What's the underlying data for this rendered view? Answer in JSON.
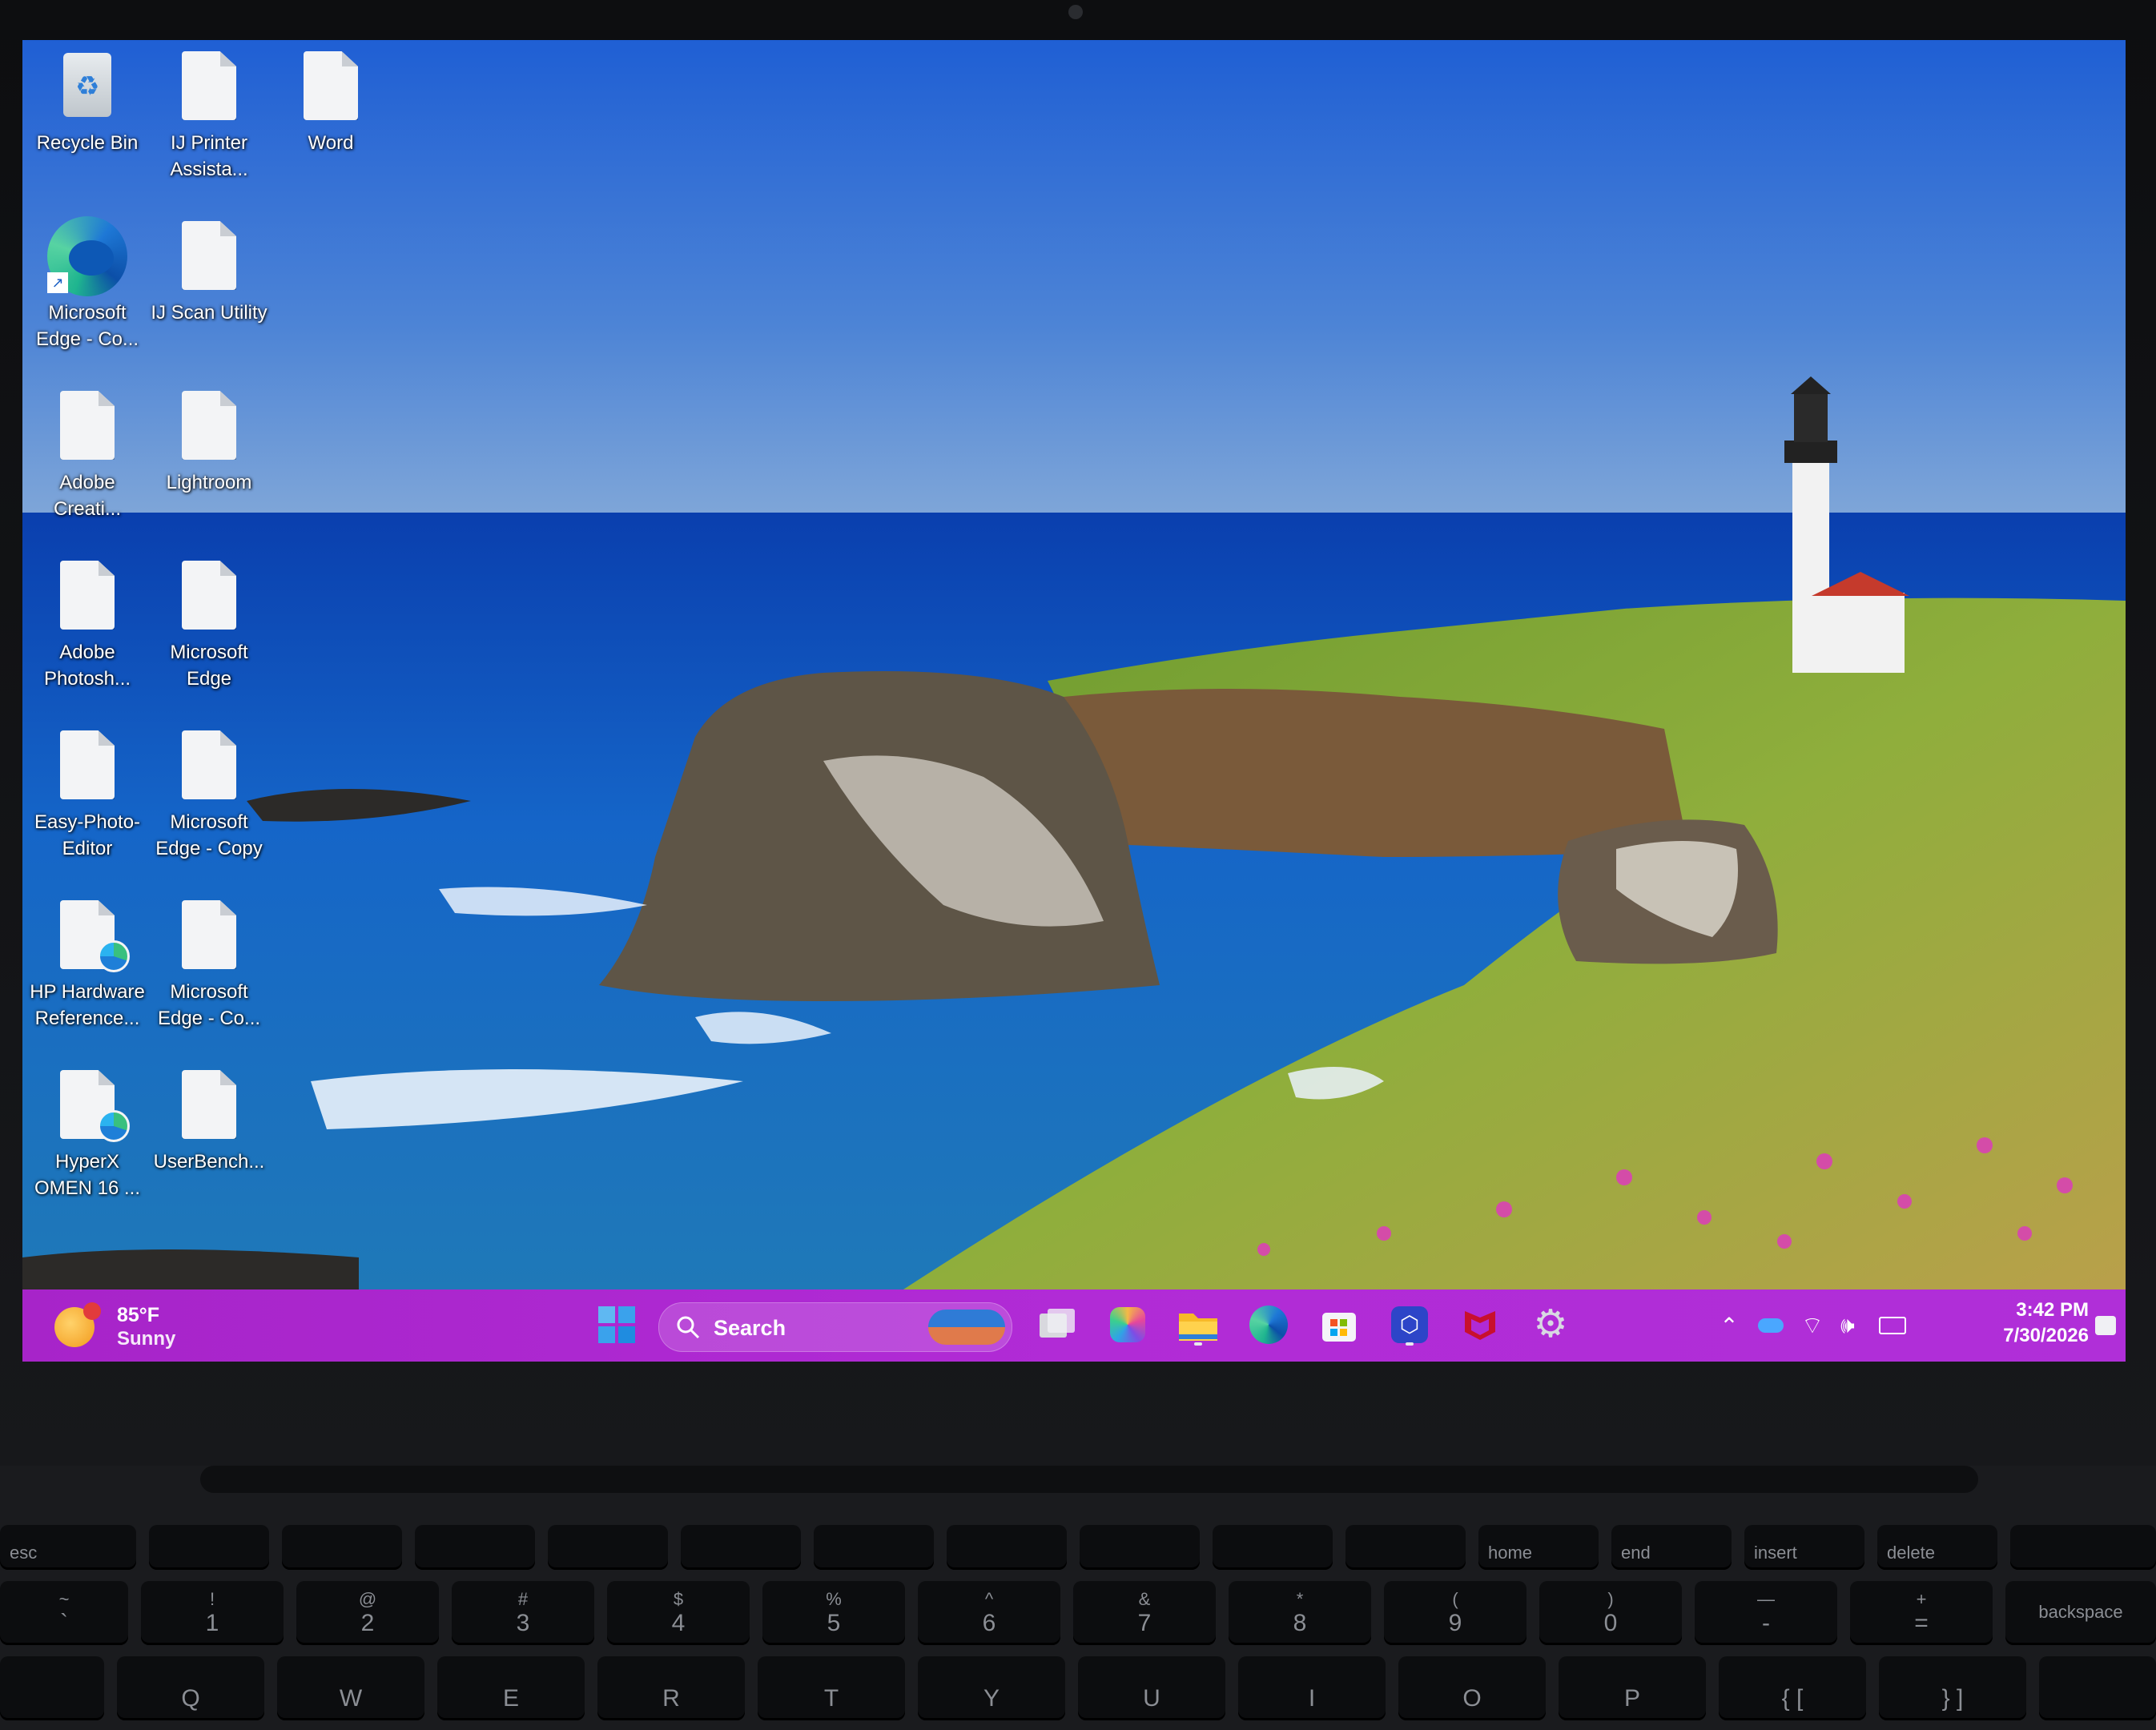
{
  "desktop": {
    "icons": [
      {
        "label": "Recycle Bin",
        "icon": "recycle-bin-icon"
      },
      {
        "label": "IJ Printer Assista...",
        "icon": "file-icon"
      },
      {
        "label": "Word",
        "icon": "file-icon"
      },
      {
        "label": "Microsoft Edge - Co...",
        "icon": "edge-icon"
      },
      {
        "label": "IJ Scan Utility",
        "icon": "file-icon"
      },
      {
        "label": "Adobe Creati...",
        "icon": "file-icon"
      },
      {
        "label": "Lightroom",
        "icon": "file-icon"
      },
      {
        "label": "Adobe Photosh...",
        "icon": "file-icon"
      },
      {
        "label": "Microsoft Edge",
        "icon": "file-icon"
      },
      {
        "label": "Easy-Photo-Editor",
        "icon": "file-icon"
      },
      {
        "label": "Microsoft Edge - Copy",
        "icon": "file-icon"
      },
      {
        "label": "HP Hardware Reference...",
        "icon": "file-edge-icon"
      },
      {
        "label": "Microsoft Edge - Co...",
        "icon": "file-icon"
      },
      {
        "label": "HyperX OMEN 16 ...",
        "icon": "file-edge-icon"
      },
      {
        "label": "UserBench...",
        "icon": "file-icon"
      }
    ]
  },
  "taskbar": {
    "color": "#b02bd6",
    "weather": {
      "temp": "85°F",
      "condition": "Sunny",
      "badge": "1"
    },
    "search": {
      "label": "Search"
    },
    "apps": [
      "start-icon",
      "task-view-icon",
      "copilot-icon",
      "file-explorer-icon",
      "edge-icon",
      "store-icon",
      "security-app-icon",
      "mcafee-icon",
      "settings-icon"
    ],
    "tray": [
      "chevron-up-icon",
      "onedrive-icon",
      "wifi-icon",
      "volume-icon",
      "battery-icon"
    ],
    "clock": {
      "time": "3:42 PM",
      "date": "7/30/2026"
    }
  },
  "keyboard": {
    "fn_row": [
      "esc",
      "",
      "",
      "",
      "",
      "",
      "",
      "",
      "",
      "",
      "",
      "home",
      "end",
      "insert",
      "delete"
    ],
    "number_row": [
      {
        "top": "~",
        "main": "`"
      },
      {
        "top": "!",
        "main": "1"
      },
      {
        "top": "@",
        "main": "2"
      },
      {
        "top": "#",
        "main": "3"
      },
      {
        "top": "$",
        "main": "4"
      },
      {
        "top": "%",
        "main": "5"
      },
      {
        "top": "^",
        "main": "6"
      },
      {
        "top": "&",
        "main": "7"
      },
      {
        "top": "*",
        "main": "8"
      },
      {
        "top": "(",
        "main": "9"
      },
      {
        "top": ")",
        "main": "0"
      },
      {
        "top": "—",
        "main": "-"
      },
      {
        "top": "+",
        "main": "="
      },
      {
        "top": "",
        "main": "backspace"
      }
    ],
    "letter_row": [
      "",
      "Q",
      "W",
      "E",
      "R",
      "T",
      "Y",
      "U",
      "I",
      "O",
      "P",
      "{ [",
      "} ]"
    ]
  }
}
